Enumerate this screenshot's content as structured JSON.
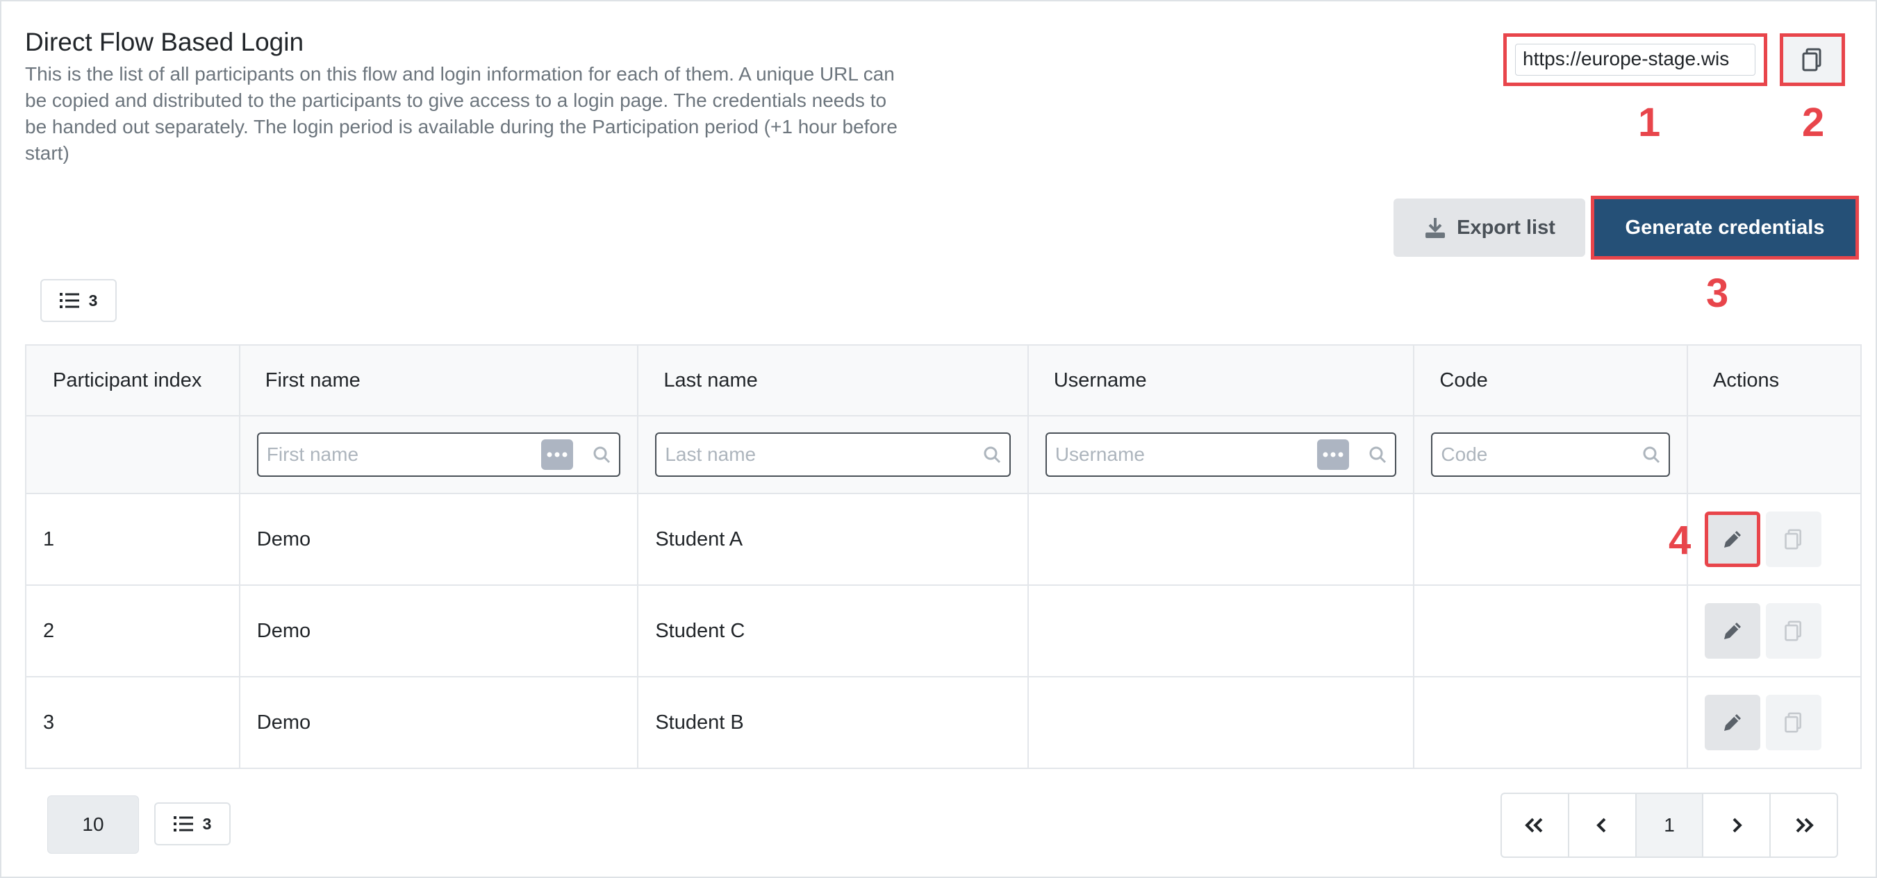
{
  "header": {
    "title": "Direct Flow Based Login",
    "description": "This is the list of all participants on this flow and login information for each of them. A unique URL can be copied and distributed to the participants to give access to a login page. The credentials needs to be handed out separately. The login period is available during the Participation period (+1 hour before start)"
  },
  "url_field": {
    "value": "https://europe-stage.wis"
  },
  "annotations": {
    "m1": "1",
    "m2": "2",
    "m3": "3",
    "m4": "4"
  },
  "toolbar": {
    "export_label": "Export list",
    "generate_label": "Generate credentials",
    "column_count": "3"
  },
  "table": {
    "columns": [
      "Participant index",
      "First name",
      "Last name",
      "Username",
      "Code",
      "Actions"
    ],
    "filters": {
      "first_name": "First name",
      "last_name": "Last name",
      "username": "Username",
      "code": "Code"
    },
    "rows": [
      {
        "index": "1",
        "first": "Demo",
        "last": "Student A",
        "username": "",
        "code": ""
      },
      {
        "index": "2",
        "first": "Demo",
        "last": "Student C",
        "username": "",
        "code": ""
      },
      {
        "index": "3",
        "first": "Demo",
        "last": "Student B",
        "username": "",
        "code": ""
      }
    ]
  },
  "footer": {
    "page_size": "10",
    "column_count": "3",
    "current_page": "1"
  },
  "colors": {
    "primary": "#255077",
    "highlight": "#e8454b",
    "muted_text": "#6c757d"
  },
  "icons": [
    "copy-icon",
    "download-icon",
    "list-icon",
    "search-icon",
    "ellipsis-icon",
    "pencil-icon",
    "first-page-icon",
    "prev-page-icon",
    "next-page-icon",
    "last-page-icon"
  ]
}
